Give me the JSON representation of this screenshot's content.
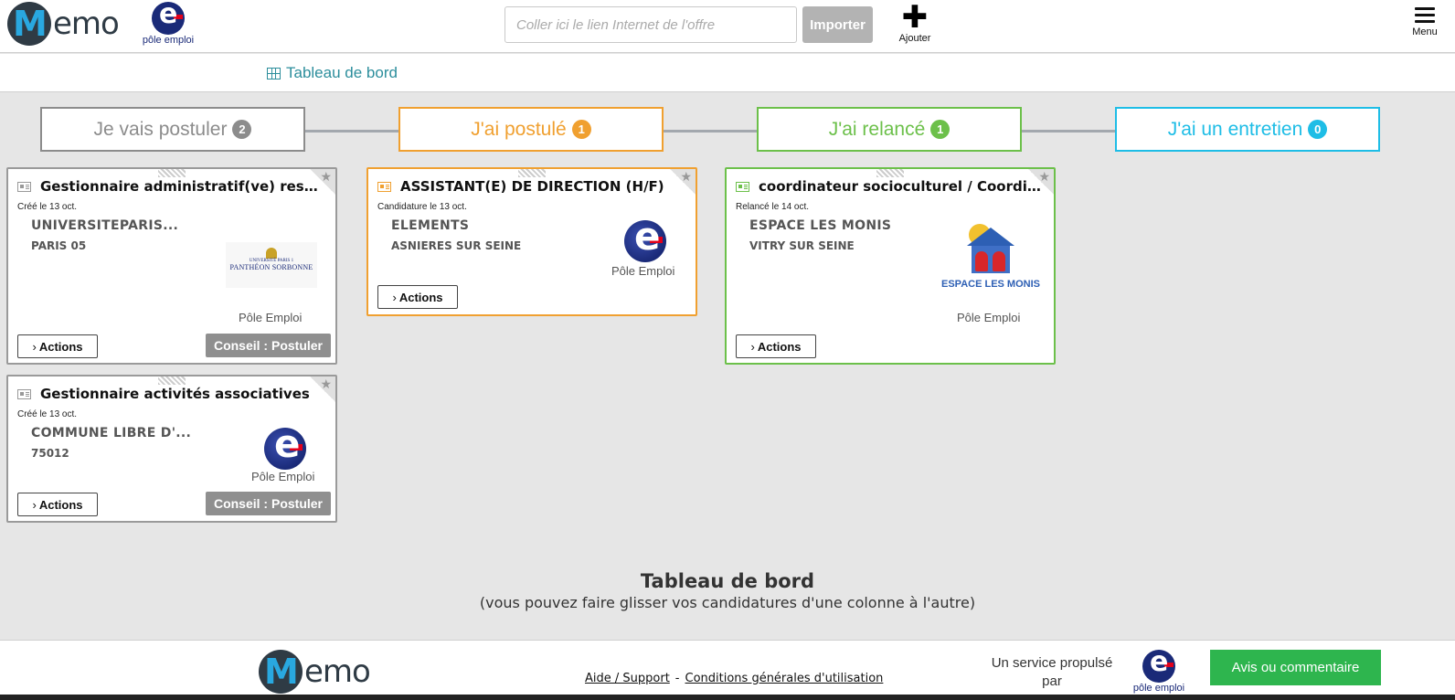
{
  "header": {
    "logo_text": "emo",
    "logo_initial": "M",
    "partner_label": "pôle emploi",
    "search_placeholder": "Coller ici le lien Internet de l'offre",
    "import_label": "Importer",
    "add_label": "Ajouter",
    "menu_label": "Menu"
  },
  "breadcrumb": {
    "label": "Tableau de bord"
  },
  "columns": [
    {
      "label": "Je vais postuler",
      "count": "2",
      "color": "#8c8c8c"
    },
    {
      "label": "J'ai postulé",
      "count": "1",
      "color": "#f0a030"
    },
    {
      "label": "J'ai relancé",
      "count": "1",
      "color": "#6cc04a"
    },
    {
      "label": "J'ai un entretien",
      "count": "0",
      "color": "#1ebde6"
    }
  ],
  "cards": [
    {
      "title": "Gestionnaire administratif(ve) ressou...",
      "date": "Créé le 13 oct.",
      "company": "UNIVERSITEPARIS...",
      "city": "PARIS 05",
      "logo_text_1": "UNIVERSITÉ PARIS 1",
      "logo_text_2": "PANTHÉON SORBONNE",
      "source": "Pôle Emploi",
      "actions_label": "Actions",
      "advice_label": "Conseil : Postuler"
    },
    {
      "title": "Gestionnaire activités associatives",
      "date": "Créé le 13 oct.",
      "company": "COMMUNE LIBRE D'...",
      "city": "75012",
      "source": "Pôle Emploi",
      "actions_label": "Actions",
      "advice_label": "Conseil : Postuler"
    },
    {
      "title": "ASSISTANT(E) DE DIRECTION (H/F)",
      "date": "Candidature le 13 oct.",
      "company": "ELEMENTS",
      "city": "ASNIERES SUR SEINE",
      "source": "Pôle Emploi",
      "actions_label": "Actions"
    },
    {
      "title": "coordinateur socioculturel / Coordina...",
      "date": "Relancé le 14 oct.",
      "company": "ESPACE LES MONIS",
      "city": "VITRY SUR SEINE",
      "logo_text": "ESPACE LES MONIS",
      "source": "Pôle Emploi",
      "actions_label": "Actions"
    }
  ],
  "hint": {
    "title": "Tableau de bord",
    "subtitle": "(vous pouvez faire glisser vos candidatures d'une colonne à l'autre)"
  },
  "footer": {
    "help_link": "Aide / Support",
    "separator": "-",
    "terms_link": "Conditions générales d'utilisation",
    "service_text": "Un service propulsé par",
    "partner_label": "pôle emploi",
    "feedback_label": "Avis ou commentaire"
  }
}
